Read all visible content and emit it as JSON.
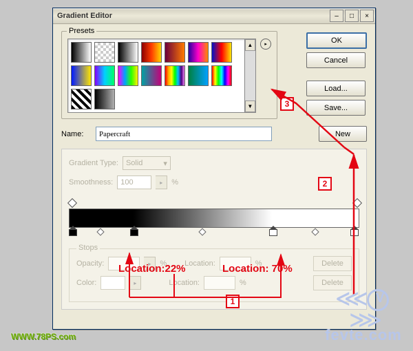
{
  "window": {
    "title": "Gradient Editor",
    "controls": {
      "min": "–",
      "max": "□",
      "close": "×"
    }
  },
  "buttons": {
    "ok": "OK",
    "cancel": "Cancel",
    "load": "Load...",
    "save": "Save...",
    "new": "New"
  },
  "presets": {
    "legend": "Presets",
    "flyout_glyph": "▸",
    "scroll_up": "▲",
    "scroll_down": "▼",
    "swatches": [
      "linear-gradient(90deg,#000,#fff)",
      "repeating-conic-gradient(#ccc 0 25%,#fff 0 50%) 0 0/8px 8px,linear-gradient(90deg,#000,transparent)",
      "linear-gradient(90deg,#000,#fff)",
      "linear-gradient(90deg,#8b0000,#ff3b00,#ffd400)",
      "linear-gradient(90deg,#6b003b,#ff7a00)",
      "linear-gradient(90deg,#2a00a0,#ff00c8,#ff8a00)",
      "linear-gradient(90deg,#0014c8,#ff0000,#ffe600)",
      "linear-gradient(90deg,#001aff,#ffe600)",
      "linear-gradient(90deg,#8400ff,#00d0ff,#00ff66)",
      "linear-gradient(90deg,#ff00ff,#00a2ff,#2bff00,#ffee00)",
      "linear-gradient(90deg,#00a3a3,#c4007a)",
      "linear-gradient(90deg,#ff0000,#ffa500,#ffff00,#00ff00,#00bfff,#4b0082,#ee82ee)",
      "linear-gradient(90deg,#008040,#00a0ff)",
      "linear-gradient(90deg,#ff0000,#ffff00,#00ff00,#00ffff,#0000ff,#ff00ff,#ff0000)",
      "repeating-linear-gradient(45deg,#000 0 4px,#fff 4px 8px)",
      "linear-gradient(90deg,#000,#b0b0b0)"
    ]
  },
  "name": {
    "label": "Name:",
    "value": "Papercraft"
  },
  "gradientType": {
    "label": "Gradient Type:",
    "value": "Solid",
    "smoothness_label": "Smoothness:",
    "smoothness_value": "100",
    "percent": "%"
  },
  "stopsPanel": {
    "legend": "Stops",
    "opacity_label": "Opacity:",
    "location_label": "Location:",
    "color_label": "Color:",
    "delete": "Delete",
    "percent": "%"
  },
  "annotations": {
    "loc1": "Location:22%",
    "loc2": "Location: 70%",
    "n1": "1",
    "n2": "2",
    "n3": "3"
  },
  "watermarks": {
    "site1": "WWW.78PS.com",
    "site2": "fevte.com"
  }
}
